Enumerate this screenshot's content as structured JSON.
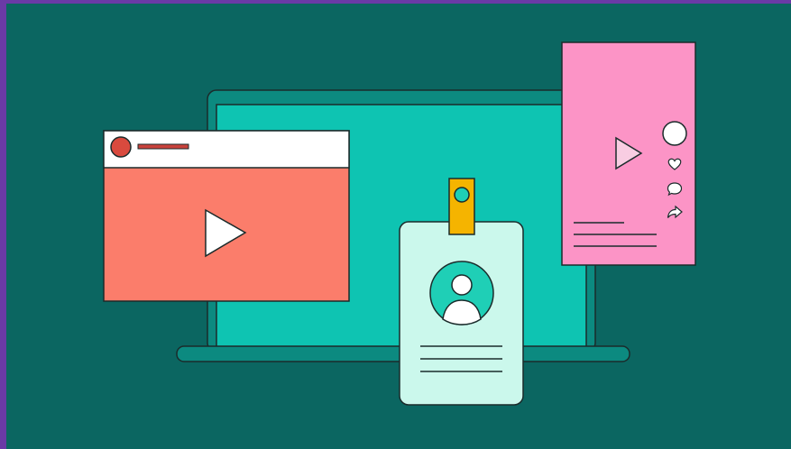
{
  "illustration": {
    "colors": {
      "background": "#0b6661",
      "frame": "#6a3aa6",
      "laptop_body": "#0c8a80",
      "laptop_screen": "#0ec4b2",
      "outline": "#1b2b2b",
      "video_window_bg": "#fb7d6b",
      "video_header_bg": "#ffffff",
      "avatar_dot": "#d94a3e",
      "title_bar": "#c8423b",
      "play_icon": "#ffffff",
      "phone_card_bg": "#fc94c6",
      "phone_play_icon": "#f8cde2",
      "id_badge_bg": "#cbf8ec",
      "id_clip": "#f5b400",
      "id_avatar_circle": "#1fcfb6"
    },
    "icons": {
      "video_play": "play-icon",
      "phone_play": "play-icon",
      "like": "heart-icon",
      "comment": "comment-icon",
      "share": "share-icon",
      "profile": "user-icon"
    }
  }
}
